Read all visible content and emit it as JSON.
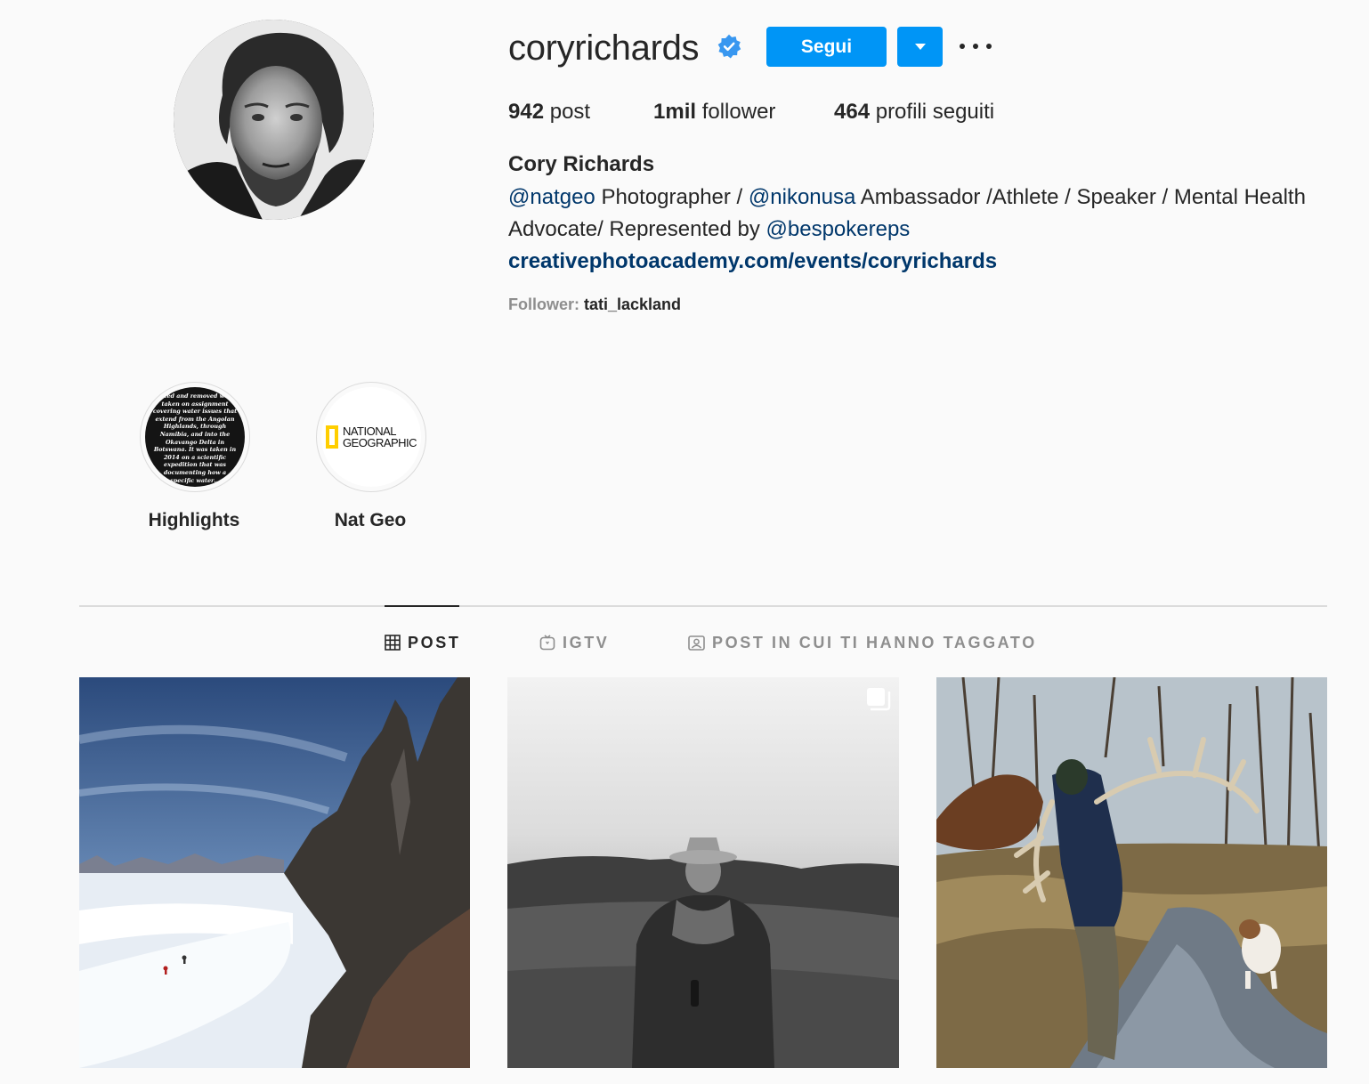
{
  "profile": {
    "username": "coryrichards",
    "verified": true,
    "follow_label": "Segui",
    "stats": {
      "posts_count": "942",
      "posts_label": "post",
      "followers_count": "1mil",
      "followers_label": "follower",
      "following_count": "464",
      "following_label": "profili seguiti"
    },
    "full_name": "Cory Richards",
    "bio": {
      "mention_natgeo": "@natgeo",
      "text1": " Photographer / ",
      "mention_nikonusa": "@nikonusa",
      "text2": " Ambassador /Athlete / Speaker / Mental Health Advocate/ Represented by ",
      "mention_bespokereps": "@bespokereps"
    },
    "link": "creativephotoacademy.com/events/coryrichards",
    "followed_by_label": "Follower: ",
    "followed_by_user": "tati_lackland"
  },
  "highlights": [
    {
      "label": "Highlights",
      "cover_text": "…ted and removed was taken on assignment covering water issues that extend from the Angolan Highlands, through Namibia, and into the Okavango Delta in Botswana. It was taken in 2014 on a scientific expedition that was documenting how a specific water…"
    },
    {
      "label": "Nat Geo",
      "logo_line1": "NATIONAL",
      "logo_line2": "GEOGRAPHIC"
    }
  ],
  "tabs": [
    {
      "label": "POST",
      "icon": "grid-icon",
      "active": true
    },
    {
      "label": "IGTV",
      "icon": "igtv-icon",
      "active": false
    },
    {
      "label": "POST IN CUI TI HANNO TAGGATO",
      "icon": "tagged-icon",
      "active": false
    }
  ],
  "colors": {
    "accent": "#0095f6",
    "link": "#00376b",
    "text": "#262626",
    "muted": "#8e8e8e",
    "verified": "#3897f0"
  }
}
